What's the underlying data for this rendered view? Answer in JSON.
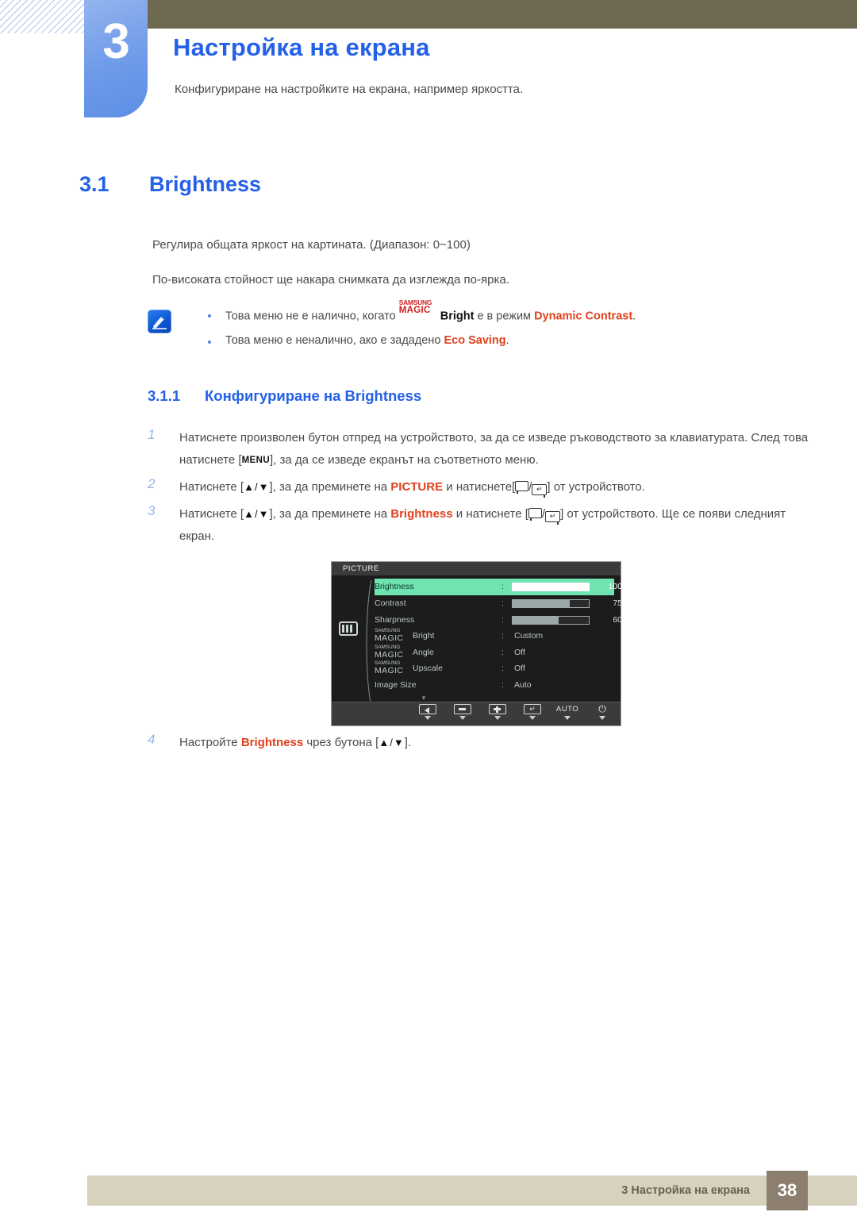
{
  "chapter": {
    "number": "3",
    "title": "Настройка на екрана",
    "subtitle": "Конфигуриране на настройките на екрана, например яркостта."
  },
  "section": {
    "number": "3.1",
    "title": "Brightness",
    "paragraph1": "Регулира общата яркост на картината. (Диапазон: 0~100)",
    "paragraph2": "По-високата стойност ще накара снимката да изглежда по-ярка."
  },
  "note": {
    "icon": "note-pen-icon",
    "bullet1": {
      "pre": "Това меню не е налично, когато",
      "magic_top": "SAMSUNG",
      "magic_bottom": "MAGIC",
      "magic_suffix": "Bright",
      "mid": "е в режим",
      "highlight": "Dynamic Contrast",
      "post": "."
    },
    "bullet2": {
      "pre": "Това меню е неналично, ако е зададено",
      "highlight": "Eco Saving",
      "post": "."
    }
  },
  "subsection": {
    "number": "3.1.1",
    "title": "Конфигуриране на Brightness"
  },
  "steps": [
    {
      "index": "1",
      "part1": "Натиснете произволен бутон отпред на устройството, за да се изведе ръководството за клавиатурата. След това натиснете [",
      "key": "MENU",
      "part2": "], за да се изведе екранът на съответното меню."
    },
    {
      "index": "2",
      "part1": "Натиснете [",
      "arrows": "▲/▼",
      "part2": "], за да преминете на",
      "highlight": "PICTURE",
      "part3": "и натиснете[",
      "part4": "] от устройството."
    },
    {
      "index": "3",
      "part1": "Натиснете [",
      "arrows": "▲/▼",
      "part2": "], за да преминете на",
      "highlight": "Brightness",
      "part3": "и натиснете [",
      "part4": "] от устройството. Ще се появи следният екран."
    },
    {
      "index": "4",
      "part1": "Настройте",
      "highlight": "Brightness",
      "part2": "чрез бутона [",
      "arrows": "▲/▼",
      "part3": "]."
    }
  ],
  "osd": {
    "title": "PICTURE",
    "side_icon": "picture-mode-icon",
    "rows": [
      {
        "label": "Brightness",
        "type": "bar",
        "value": "100",
        "fill": 100,
        "active": true
      },
      {
        "label": "Contrast",
        "type": "bar",
        "value": "75",
        "fill": 75,
        "active": false
      },
      {
        "label": "Sharpness",
        "type": "bar",
        "value": "60",
        "fill": 60,
        "active": false
      },
      {
        "label": "Bright",
        "type": "magic",
        "magic_top": "SAMSUNG",
        "magic_bottom": "MAGIC",
        "value": "Custom",
        "active": false
      },
      {
        "label": "Angle",
        "type": "magic",
        "magic_top": "SAMSUNG",
        "magic_bottom": "MAGIC",
        "value": "Off",
        "active": false
      },
      {
        "label": "Upscale",
        "type": "magic",
        "magic_top": "SAMSUNG",
        "magic_bottom": "MAGIC",
        "value": "Off",
        "active": false
      },
      {
        "label": "Image Size",
        "type": "text",
        "value": "Auto",
        "active": false
      }
    ],
    "more_caret": "▼",
    "buttons": [
      {
        "name": "back-button",
        "kind": "back",
        "label": ""
      },
      {
        "name": "minus-button",
        "kind": "minus",
        "label": ""
      },
      {
        "name": "plus-button",
        "kind": "plus",
        "label": ""
      },
      {
        "name": "enter-button",
        "kind": "enter",
        "label": "↵"
      },
      {
        "name": "auto-button",
        "kind": "text",
        "label": "AUTO"
      },
      {
        "name": "power-button",
        "kind": "power",
        "label": "⏻"
      }
    ]
  },
  "footer": {
    "text": "3 Настройка на екрана",
    "page": "38"
  },
  "colors": {
    "accent_blue": "#2461e8",
    "header_olive": "#6d6a51",
    "highlight_red": "#e2401c",
    "magic_red": "#cf1f1f",
    "osd_highlight": "#6fe3b0",
    "footer_beige": "#d6d2be",
    "footer_badge": "#8c7f70"
  }
}
